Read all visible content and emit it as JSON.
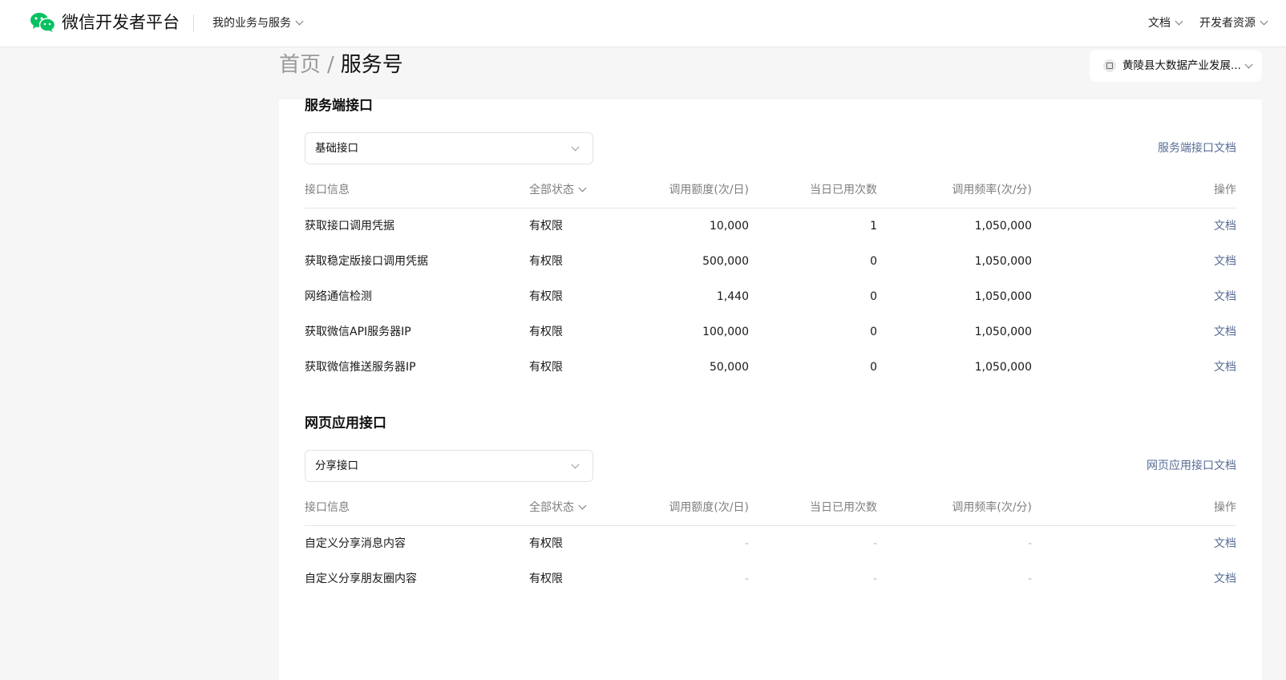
{
  "header": {
    "brand": "微信开发者平台",
    "menu": "我的业务与服务",
    "nav_docs": "文档",
    "nav_resources": "开发者资源",
    "logo_icon": "wechat-logo-icon",
    "brand_color": "#07c160"
  },
  "breadcrumb": {
    "home": "首页",
    "separator": "/",
    "current": "服务号"
  },
  "account": {
    "name": "黄陵县大数据产业发展...",
    "icon": "switch-account-icon"
  },
  "sections": [
    {
      "title": "服务端接口",
      "select": "基础接口",
      "doc_link": "服务端接口文档",
      "columns": [
        "接口信息",
        "全部状态",
        "调用额度(次/日)",
        "当日已用次数",
        "调用频率(次/分)",
        "操作"
      ],
      "rows": [
        {
          "name": "获取接口调用凭据",
          "status": "有权限",
          "quota": "10,000",
          "used": "1",
          "freq": "1,050,000",
          "action": "文档"
        },
        {
          "name": "获取稳定版接口调用凭据",
          "status": "有权限",
          "quota": "500,000",
          "used": "0",
          "freq": "1,050,000",
          "action": "文档"
        },
        {
          "name": "网络通信检测",
          "status": "有权限",
          "quota": "1,440",
          "used": "0",
          "freq": "1,050,000",
          "action": "文档"
        },
        {
          "name": "获取微信API服务器IP",
          "status": "有权限",
          "quota": "100,000",
          "used": "0",
          "freq": "1,050,000",
          "action": "文档"
        },
        {
          "name": "获取微信推送服务器IP",
          "status": "有权限",
          "quota": "50,000",
          "used": "0",
          "freq": "1,050,000",
          "action": "文档"
        }
      ]
    },
    {
      "title": "网页应用接口",
      "select": "分享接口",
      "doc_link": "网页应用接口文档",
      "columns": [
        "接口信息",
        "全部状态",
        "调用额度(次/日)",
        "当日已用次数",
        "调用频率(次/分)",
        "操作"
      ],
      "rows": [
        {
          "name": "自定义分享消息内容",
          "status": "有权限",
          "quota": "-",
          "used": "-",
          "freq": "-",
          "action": "文档"
        },
        {
          "name": "自定义分享朋友圈内容",
          "status": "有权限",
          "quota": "-",
          "used": "-",
          "freq": "-",
          "action": "文档"
        }
      ]
    }
  ]
}
